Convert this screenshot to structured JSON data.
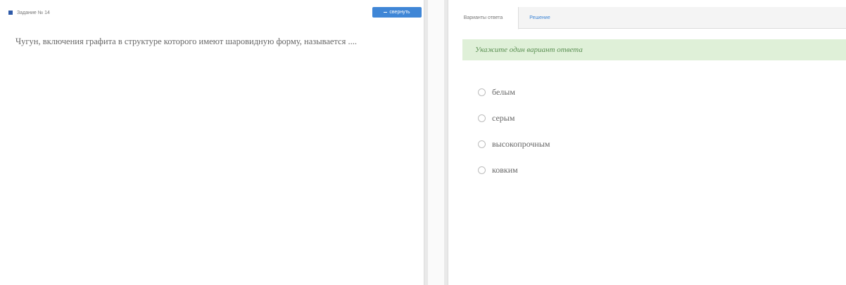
{
  "task": {
    "title": "Задание № 14",
    "collapse_label": "свернуть"
  },
  "question": "Чугун, включения графита в структуре которого имеют шаровидную форму, называется ....",
  "tabs": [
    {
      "label": "Варианты ответа"
    },
    {
      "label": "Решение"
    }
  ],
  "notice": "Укажите один вариант ответа",
  "options": [
    {
      "label": "белым"
    },
    {
      "label": "серым"
    },
    {
      "label": "высокопрочным"
    },
    {
      "label": "ковким"
    }
  ]
}
